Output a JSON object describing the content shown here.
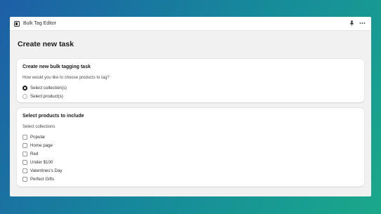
{
  "window": {
    "title": "Bulk Tag Editor",
    "icons": [
      "app-icon",
      "pin-icon",
      "more-icon"
    ]
  },
  "page": {
    "title": "Create new task"
  },
  "task_card": {
    "title": "Create new bulk tagging task",
    "question": "How would you like to choose products to tag?",
    "options": [
      {
        "label": "Select collection(s)",
        "selected": true
      },
      {
        "label": "Select product(s)",
        "selected": false
      }
    ]
  },
  "products_card": {
    "title": "Select products to include",
    "subtitle": "Select collections",
    "collections": [
      {
        "label": "Popular",
        "checked": false
      },
      {
        "label": "Home page",
        "checked": false
      },
      {
        "label": "Red",
        "checked": false
      },
      {
        "label": "Under $100",
        "checked": false
      },
      {
        "label": "Valentines's Day",
        "checked": false
      },
      {
        "label": "Perfect Gifts",
        "checked": false
      }
    ]
  },
  "colors": {
    "background_start": "#1d5fa6",
    "background_end": "#1aa88a",
    "window_bg": "#f1f1f1",
    "card_bg": "#ffffff",
    "text": "#303030"
  }
}
